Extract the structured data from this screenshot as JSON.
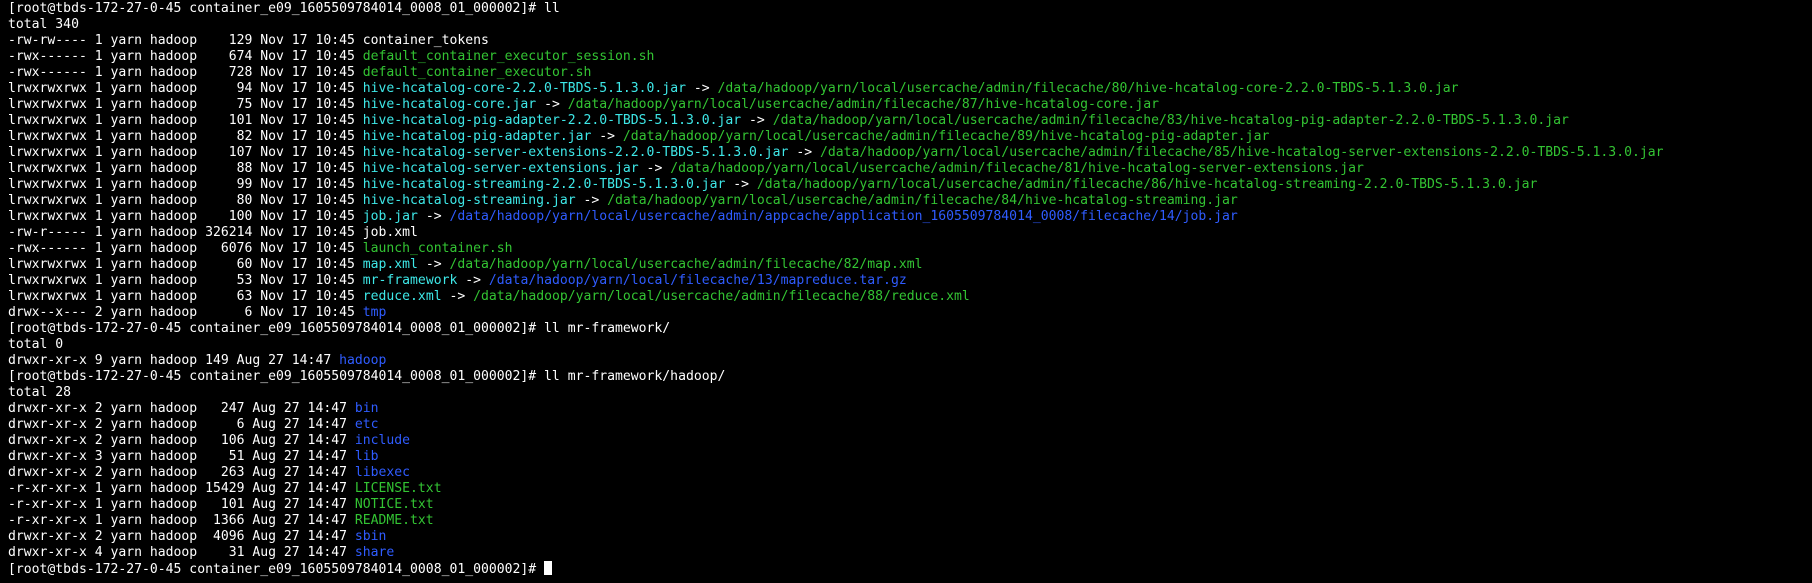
{
  "window": {
    "background": "#000000"
  },
  "colors": {
    "normal": "#ffffff",
    "executable": "#33c433",
    "symlink": "#3ee8e8",
    "directory": "#2f5cff"
  },
  "lines": [
    {
      "kind": "prompt",
      "text": "[root@tbds-172-27-0-45 container_e09_1605509784014_0008_01_000002]# ll"
    },
    {
      "kind": "plain",
      "text": "total 340"
    },
    {
      "kind": "entry",
      "meta": "-rw-rw---- 1 yarn hadoop    129 Nov 17 10:45 ",
      "name": "container_tokens",
      "style": "normal"
    },
    {
      "kind": "entry",
      "meta": "-rwx------ 1 yarn hadoop    674 Nov 17 10:45 ",
      "name": "default_container_executor_session.sh",
      "style": "exec"
    },
    {
      "kind": "entry",
      "meta": "-rwx------ 1 yarn hadoop    728 Nov 17 10:45 ",
      "name": "default_container_executor.sh",
      "style": "exec"
    },
    {
      "kind": "link",
      "meta": "lrwxrwxrwx 1 yarn hadoop     94 Nov 17 10:45 ",
      "name": "hive-hcatalog-core-2.2.0-TBDS-5.1.3.0.jar",
      "arrow": " -> ",
      "target": "/data/hadoop/yarn/local/usercache/admin/filecache/80/hive-hcatalog-core-2.2.0-TBDS-5.1.3.0.jar",
      "target_style": "green"
    },
    {
      "kind": "link",
      "meta": "lrwxrwxrwx 1 yarn hadoop     75 Nov 17 10:45 ",
      "name": "hive-hcatalog-core.jar",
      "arrow": " -> ",
      "target": "/data/hadoop/yarn/local/usercache/admin/filecache/87/hive-hcatalog-core.jar",
      "target_style": "green"
    },
    {
      "kind": "link",
      "meta": "lrwxrwxrwx 1 yarn hadoop    101 Nov 17 10:45 ",
      "name": "hive-hcatalog-pig-adapter-2.2.0-TBDS-5.1.3.0.jar",
      "arrow": " -> ",
      "target": "/data/hadoop/yarn/local/usercache/admin/filecache/83/hive-hcatalog-pig-adapter-2.2.0-TBDS-5.1.3.0.jar",
      "target_style": "green"
    },
    {
      "kind": "link",
      "meta": "lrwxrwxrwx 1 yarn hadoop     82 Nov 17 10:45 ",
      "name": "hive-hcatalog-pig-adapter.jar",
      "arrow": " -> ",
      "target": "/data/hadoop/yarn/local/usercache/admin/filecache/89/hive-hcatalog-pig-adapter.jar",
      "target_style": "green"
    },
    {
      "kind": "link",
      "meta": "lrwxrwxrwx 1 yarn hadoop    107 Nov 17 10:45 ",
      "name": "hive-hcatalog-server-extensions-2.2.0-TBDS-5.1.3.0.jar",
      "arrow": " -> ",
      "target": "/data/hadoop/yarn/local/usercache/admin/filecache/85/hive-hcatalog-server-extensions-2.2.0-TBDS-5.1.3.0.jar",
      "target_style": "green"
    },
    {
      "kind": "link",
      "meta": "lrwxrwxrwx 1 yarn hadoop     88 Nov 17 10:45 ",
      "name": "hive-hcatalog-server-extensions.jar",
      "arrow": " -> ",
      "target": "/data/hadoop/yarn/local/usercache/admin/filecache/81/hive-hcatalog-server-extensions.jar",
      "target_style": "green"
    },
    {
      "kind": "link",
      "meta": "lrwxrwxrwx 1 yarn hadoop     99 Nov 17 10:45 ",
      "name": "hive-hcatalog-streaming-2.2.0-TBDS-5.1.3.0.jar",
      "arrow": " -> ",
      "target": "/data/hadoop/yarn/local/usercache/admin/filecache/86/hive-hcatalog-streaming-2.2.0-TBDS-5.1.3.0.jar",
      "target_style": "green"
    },
    {
      "kind": "link",
      "meta": "lrwxrwxrwx 1 yarn hadoop     80 Nov 17 10:45 ",
      "name": "hive-hcatalog-streaming.jar",
      "arrow": " -> ",
      "target": "/data/hadoop/yarn/local/usercache/admin/filecache/84/hive-hcatalog-streaming.jar",
      "target_style": "green"
    },
    {
      "kind": "link",
      "meta": "lrwxrwxrwx 1 yarn hadoop    100 Nov 17 10:45 ",
      "name": "job.jar",
      "arrow": " -> ",
      "target": "/data/hadoop/yarn/local/usercache/admin/appcache/application_1605509784014_0008/filecache/14/job.jar",
      "target_style": "blue"
    },
    {
      "kind": "entry",
      "meta": "-rw-r----- 1 yarn hadoop 326214 Nov 17 10:45 ",
      "name": "job.xml",
      "style": "normal"
    },
    {
      "kind": "entry",
      "meta": "-rwx------ 1 yarn hadoop   6076 Nov 17 10:45 ",
      "name": "launch_container.sh",
      "style": "exec"
    },
    {
      "kind": "link",
      "meta": "lrwxrwxrwx 1 yarn hadoop     60 Nov 17 10:45 ",
      "name": "map.xml",
      "arrow": " -> ",
      "target": "/data/hadoop/yarn/local/usercache/admin/filecache/82/map.xml",
      "target_style": "green"
    },
    {
      "kind": "link",
      "meta": "lrwxrwxrwx 1 yarn hadoop     53 Nov 17 10:45 ",
      "name": "mr-framework",
      "arrow": " -> ",
      "target": "/data/hadoop/yarn/local/filecache/13/mapreduce.tar.gz",
      "target_style": "blue"
    },
    {
      "kind": "link",
      "meta": "lrwxrwxrwx 1 yarn hadoop     63 Nov 17 10:45 ",
      "name": "reduce.xml",
      "arrow": " -> ",
      "target": "/data/hadoop/yarn/local/usercache/admin/filecache/88/reduce.xml",
      "target_style": "green"
    },
    {
      "kind": "entry",
      "meta": "drwx--x--- 2 yarn hadoop      6 Nov 17 10:45 ",
      "name": "tmp",
      "style": "dir"
    },
    {
      "kind": "prompt",
      "text": "[root@tbds-172-27-0-45 container_e09_1605509784014_0008_01_000002]# ll mr-framework/"
    },
    {
      "kind": "plain",
      "text": "total 0"
    },
    {
      "kind": "entry",
      "meta": "drwxr-xr-x 9 yarn hadoop 149 Aug 27 14:47 ",
      "name": "hadoop",
      "style": "dir"
    },
    {
      "kind": "prompt",
      "text": "[root@tbds-172-27-0-45 container_e09_1605509784014_0008_01_000002]# ll mr-framework/hadoop/"
    },
    {
      "kind": "plain",
      "text": "total 28"
    },
    {
      "kind": "entry",
      "meta": "drwxr-xr-x 2 yarn hadoop   247 Aug 27 14:47 ",
      "name": "bin",
      "style": "dir"
    },
    {
      "kind": "entry",
      "meta": "drwxr-xr-x 2 yarn hadoop     6 Aug 27 14:47 ",
      "name": "etc",
      "style": "dir"
    },
    {
      "kind": "entry",
      "meta": "drwxr-xr-x 2 yarn hadoop   106 Aug 27 14:47 ",
      "name": "include",
      "style": "dir"
    },
    {
      "kind": "entry",
      "meta": "drwxr-xr-x 3 yarn hadoop    51 Aug 27 14:47 ",
      "name": "lib",
      "style": "dir"
    },
    {
      "kind": "entry",
      "meta": "drwxr-xr-x 2 yarn hadoop   263 Aug 27 14:47 ",
      "name": "libexec",
      "style": "dir"
    },
    {
      "kind": "entry",
      "meta": "-r-xr-xr-x 1 yarn hadoop 15429 Aug 27 14:47 ",
      "name": "LICENSE.txt",
      "style": "exec"
    },
    {
      "kind": "entry",
      "meta": "-r-xr-xr-x 1 yarn hadoop   101 Aug 27 14:47 ",
      "name": "NOTICE.txt",
      "style": "exec"
    },
    {
      "kind": "entry",
      "meta": "-r-xr-xr-x 1 yarn hadoop  1366 Aug 27 14:47 ",
      "name": "README.txt",
      "style": "exec"
    },
    {
      "kind": "entry",
      "meta": "drwxr-xr-x 2 yarn hadoop  4096 Aug 27 14:47 ",
      "name": "sbin",
      "style": "dir"
    },
    {
      "kind": "entry",
      "meta": "drwxr-xr-x 4 yarn hadoop    31 Aug 27 14:47 ",
      "name": "share",
      "style": "dir"
    },
    {
      "kind": "cursor",
      "text": "[root@tbds-172-27-0-45 container_e09_1605509784014_0008_01_000002]# "
    }
  ]
}
